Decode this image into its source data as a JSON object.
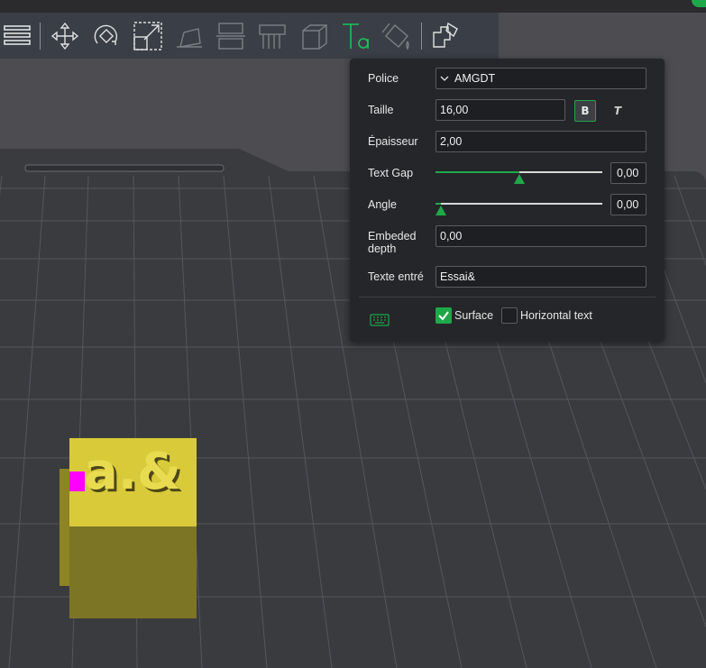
{
  "toolbar": {
    "icons": [
      "menu-icon",
      "move-icon",
      "rotate-icon",
      "scale-icon",
      "lay-on-face-icon",
      "cut-icon",
      "support-paint-icon",
      "seam-paint-icon",
      "text-tool-icon",
      "color-paint-icon",
      "assembly-icon"
    ]
  },
  "panel": {
    "font_label": "Police",
    "font_value": "AMGDT",
    "size_label": "Taille",
    "size_value": "16,00",
    "bold_label": "B",
    "italic_label": "T",
    "thickness_label": "Épaisseur",
    "thickness_value": "2,00",
    "text_gap_label": "Text Gap",
    "text_gap_value": "0,00",
    "text_gap_slider_fraction": 0.5,
    "angle_label": "Angle",
    "angle_value": "0,00",
    "angle_slider_fraction": 0.03,
    "embeded_depth_label_1": "Embeded",
    "embeded_depth_label_2": "depth",
    "embeded_depth_value": "0,00",
    "text_input_label": "Texte entré",
    "text_input_value": "Essai&",
    "surface_label": "Surface",
    "surface_checked": true,
    "horizontal_text_label": "Horizontal text",
    "horizontal_text_checked": false
  },
  "scene": {
    "model_text": "a.&",
    "colors": {
      "accent": "#1fa84a",
      "model": "#d9ca3a",
      "highlight": "#ff00ff",
      "background": "#4d4d51",
      "grid": "#333438"
    }
  }
}
